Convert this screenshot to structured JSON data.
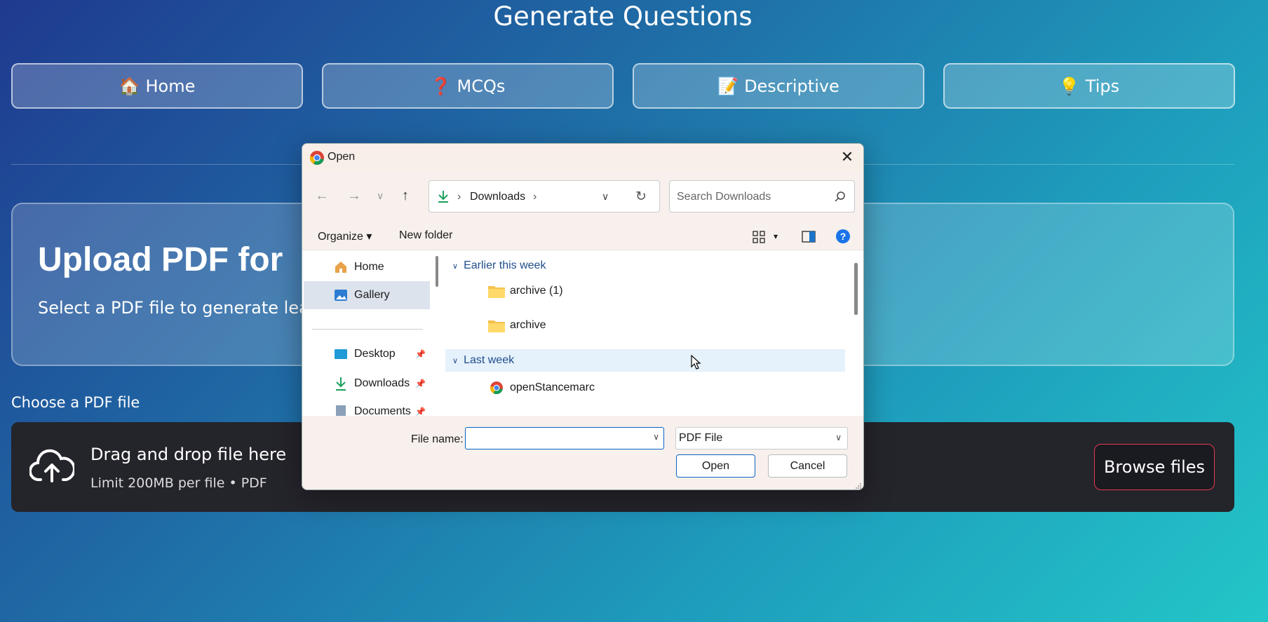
{
  "app": {
    "title": "Generate Questions"
  },
  "nav": [
    {
      "icon": "🏠",
      "label": "Home"
    },
    {
      "icon": "❓",
      "label": "MCQs"
    },
    {
      "icon": "📝",
      "label": "Descriptive"
    },
    {
      "icon": "💡",
      "label": "Tips"
    }
  ],
  "upload": {
    "title": "Upload PDF for",
    "subtitle": "Select a PDF file to generate learni",
    "choose_label": "Choose a PDF file",
    "drop_main": "Drag and drop file here",
    "drop_sub": "Limit 200MB per file • PDF",
    "browse_label": "Browse files"
  },
  "dialog": {
    "title": "Open",
    "close": "✕",
    "path": "Downloads",
    "search_placeholder": "Search Downloads",
    "organize": "Organize",
    "new_folder": "New folder",
    "nav_items": [
      "Home",
      "Gallery",
      "Desktop",
      "Downloads",
      "Documents"
    ],
    "groups": [
      {
        "label": "Earlier this week",
        "files": [
          "archive (1)",
          "archive"
        ]
      },
      {
        "label": "Last week",
        "files": [
          "openStancemarc"
        ]
      }
    ],
    "file_name_label": "File name:",
    "file_name_value": "",
    "file_type": "PDF File",
    "open_label": "Open",
    "cancel_label": "Cancel"
  },
  "colors": {
    "accent": "#0a64c4",
    "browse_border": "#e33b4d",
    "dropzone_bg": "#24242b"
  }
}
